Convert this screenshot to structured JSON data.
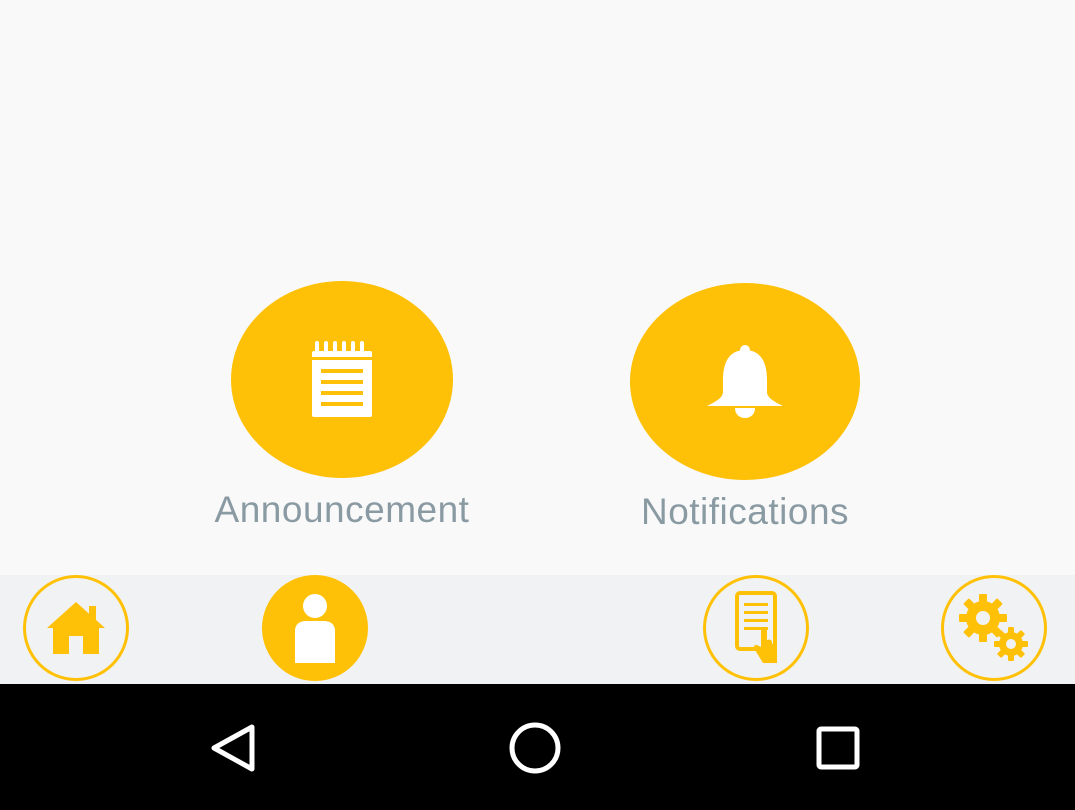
{
  "colors": {
    "accent": "#ffc107",
    "label": "#8a9aa3",
    "background": "#f9f9f9",
    "nav_background": "#f1f2f4",
    "system_bar": "#000000"
  },
  "tiles": [
    {
      "label": "Announcement",
      "icon": "notepad-icon"
    },
    {
      "label": "Notifications",
      "icon": "bell-icon"
    }
  ],
  "bottom_nav": [
    {
      "icon": "home-icon",
      "style": "outline"
    },
    {
      "icon": "person-icon",
      "style": "filled",
      "selected": true
    },
    {
      "icon": "document-touch-icon",
      "style": "outline"
    },
    {
      "icon": "gears-icon",
      "style": "outline"
    }
  ],
  "system_bar": [
    {
      "icon": "back-triangle-icon"
    },
    {
      "icon": "home-circle-icon"
    },
    {
      "icon": "recents-square-icon"
    }
  ]
}
